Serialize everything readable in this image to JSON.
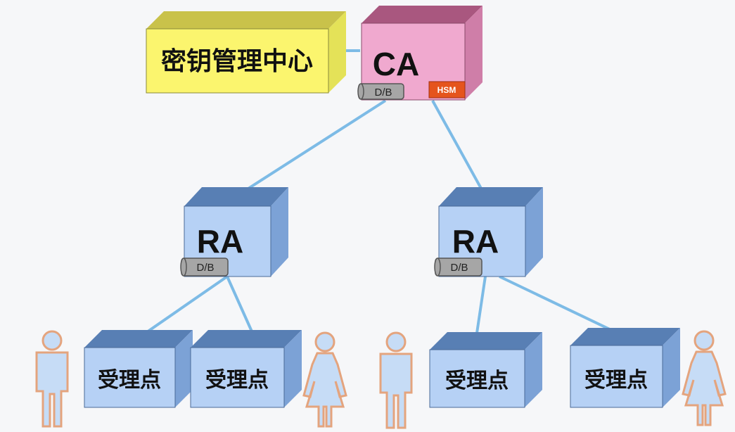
{
  "colors": {
    "kmc_front": "#fbf56e",
    "kmc_top": "#c9c24a",
    "kmc_side": "#e4e258",
    "ca_front": "#f0a9cf",
    "ca_top": "#a9577f",
    "ca_side": "#cf7ea8",
    "box_front": "#b6d1f5",
    "box_top": "#587fb4",
    "box_side": "#7ca2d6",
    "line": "#7dbbe6",
    "hsm": "#e5541c",
    "db": "#a6a6a6",
    "person_fill": "#c6dcf6",
    "person_stroke": "#e4a47e"
  },
  "kmc": {
    "label": "密钥管理中心"
  },
  "ca": {
    "label": "CA",
    "db_label": "D/B",
    "hsm_label": "HSM"
  },
  "ra_nodes": [
    {
      "label": "RA",
      "db_label": "D/B"
    },
    {
      "label": "RA",
      "db_label": "D/B"
    }
  ],
  "acceptance_points": [
    {
      "label": "受理点"
    },
    {
      "label": "受理点"
    },
    {
      "label": "受理点"
    },
    {
      "label": "受理点"
    }
  ],
  "people": [
    {
      "type": "male-person-icon"
    },
    {
      "type": "female-person-icon"
    },
    {
      "type": "male-person-icon"
    },
    {
      "type": "female-person-icon"
    }
  ]
}
